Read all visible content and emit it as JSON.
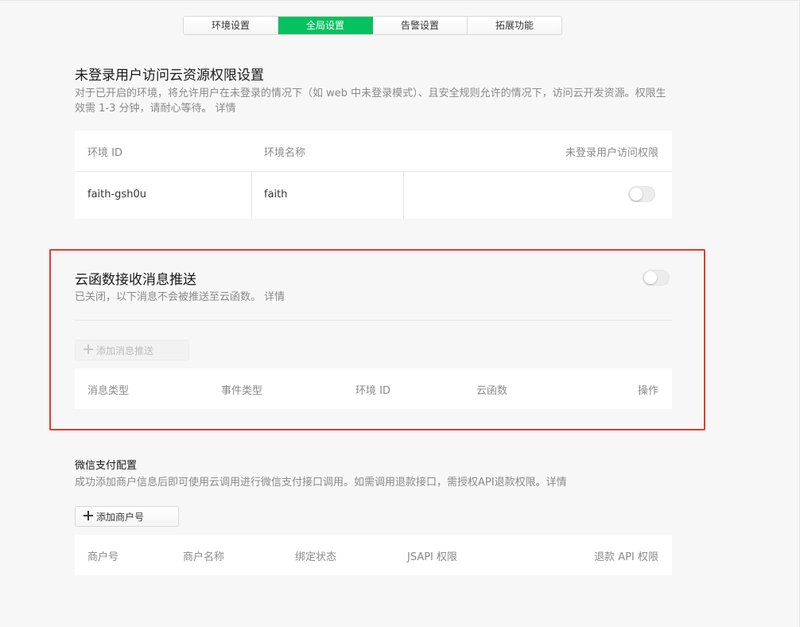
{
  "tabs": [
    {
      "label": "环境设置",
      "active": false
    },
    {
      "label": "全局设置",
      "active": true
    },
    {
      "label": "告警设置",
      "active": false
    },
    {
      "label": "拓展功能",
      "active": false
    }
  ],
  "access": {
    "title": "未登录用户访问云资源权限设置",
    "description_line1": "对于已开启的环境，将允许用户在未登录的情况下（如 web 中未登录模式）、且安全规则允许的情况下，访问云开发资源。权限生",
    "description_line2": "效需 1-3 分钟，请耐心等待。",
    "details_link": "详情",
    "columns": [
      "环境 ID",
      "环境名称",
      "未登录用户访问权限"
    ],
    "rows": [
      {
        "env_id": "faith-gsh0u",
        "env_name": "faith",
        "enabled": false
      }
    ]
  },
  "push": {
    "title": "云函数接收消息推送",
    "enabled": false,
    "status_text": "已关闭，以下消息不会被推送至云函数。",
    "details_link": "详情",
    "add_button": "添加消息推送",
    "columns": [
      "消息类型",
      "事件类型",
      "环境 ID",
      "云函数",
      "操作"
    ]
  },
  "pay": {
    "title": "微信支付配置",
    "description": "成功添加商户信息后即可使用云调用进行微信支付接口调用。如需调用退款接口，需授权API退款权限。",
    "details_link": "详情",
    "add_button": "添加商户号",
    "columns": [
      "商户号",
      "商户名称",
      "绑定状态",
      "JSAPI 权限",
      "退款 API 权限"
    ]
  },
  "colors": {
    "accent": "#07c160",
    "highlight": "#e43a32"
  }
}
